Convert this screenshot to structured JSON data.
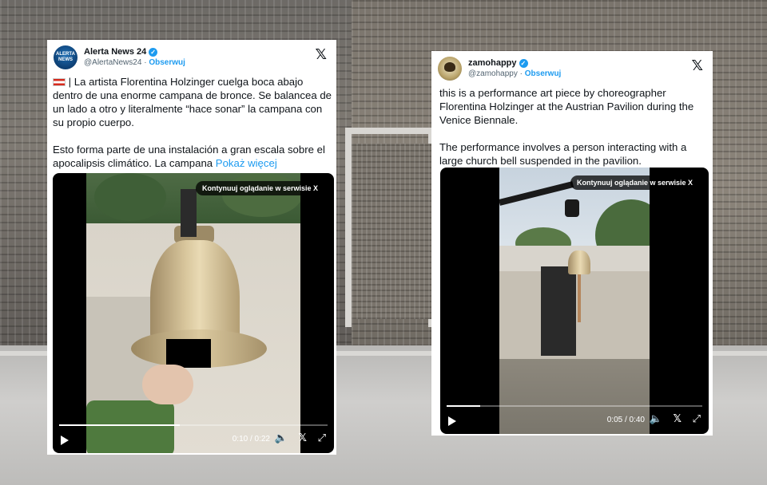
{
  "left_tweet": {
    "avatar_text": "ALERTA NEWS",
    "name": "Alerta News 24",
    "handle": "@AlertaNews24",
    "follow": "Obserwuj",
    "text_p1": " | La artista Florentina Holzinger cuelga boca abajo dentro de una enorme campana de bronce. Se balancea de un lado a otro y literalmente “hace sonar” la campana con su propio cuerpo.",
    "text_p2": "Esto forma parte de una instalación a gran escala sobre el apocalipsis climático. La campana ",
    "more": "Pokaż więcej",
    "video": {
      "badge": "Kontynuuj oglądanie w serwisie X",
      "time": "0:10 / 0:22",
      "progress": 0.45
    }
  },
  "right_tweet": {
    "name": "zamohappy",
    "handle": "@zamohappy",
    "follow": "Obserwuj",
    "text_p1": "this is a performance art piece by choreographer Florentina Holzinger at the Austrian Pavilion during the Venice Biennale.",
    "text_p2": "The performance involves a person interacting with a large church bell suspended in the pavilion.",
    "video": {
      "badge": "Kontynuuj oglądanie w serwisie X",
      "time": "0:05 / 0:40",
      "progress": 0.13
    }
  },
  "icons": {
    "dot": "·",
    "x_logo": "𝕏",
    "play": "play-icon",
    "volume": "🔈",
    "x_small": "𝕏",
    "fullscreen": "⤢"
  },
  "colors": {
    "link": "#1d9bf0",
    "verified": "#1d9bf0"
  }
}
